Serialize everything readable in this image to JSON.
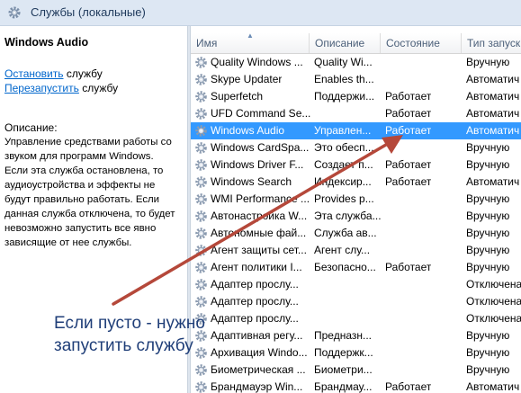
{
  "window": {
    "title": "Службы (локальные)"
  },
  "left_panel": {
    "service_name": "Windows Audio",
    "stop_link": "Остановить",
    "stop_suffix": " службу",
    "restart_link": "Перезапустить",
    "restart_suffix": " службу",
    "description_label": "Описание:",
    "description_lines": [
      "Управление средствами работы со",
      "звуком для программ Windows.",
      "Если эта служба остановлена, то",
      "аудиоустройства и эффекты не",
      "будут правильно работать.  Если",
      "данная служба отключена, то будет",
      "невозможно запустить все явно",
      "зависящие от нее службы."
    ]
  },
  "table": {
    "columns": [
      "Имя",
      "Описание",
      "Состояние",
      "Тип запуск"
    ],
    "sort_indicator": "▲",
    "rows": [
      {
        "name": "Quality Windows ...",
        "desc": "Quality Wi...",
        "state": "",
        "startup": "Вручную"
      },
      {
        "name": "Skype Updater",
        "desc": "Enables th...",
        "state": "",
        "startup": "Автоматич"
      },
      {
        "name": "Superfetch",
        "desc": "Поддержи...",
        "state": "Работает",
        "startup": "Автоматич"
      },
      {
        "name": "UFD Command Se...",
        "desc": "",
        "state": "Работает",
        "startup": "Автоматич"
      },
      {
        "name": "Windows Audio",
        "desc": "Управлен...",
        "state": "Работает",
        "startup": "Автоматич"
      },
      {
        "name": "Windows CardSpa...",
        "desc": "Это обесп...",
        "state": "",
        "startup": "Вручную"
      },
      {
        "name": "Windows Driver F...",
        "desc": "Создает п...",
        "state": "Работает",
        "startup": "Вручную"
      },
      {
        "name": "Windows Search",
        "desc": "Индексир...",
        "state": "Работает",
        "startup": "Автоматич"
      },
      {
        "name": "WMI Performance ...",
        "desc": "Provides p...",
        "state": "",
        "startup": "Вручную"
      },
      {
        "name": "Автонастройка W...",
        "desc": "Эта служба...",
        "state": "",
        "startup": "Вручную"
      },
      {
        "name": "Автономные фай...",
        "desc": "Служба ав...",
        "state": "",
        "startup": "Вручную"
      },
      {
        "name": "Агент защиты сет...",
        "desc": "Агент слу...",
        "state": "",
        "startup": "Вручную"
      },
      {
        "name": "Агент политики I...",
        "desc": "Безопасно...",
        "state": "Работает",
        "startup": "Вручную"
      },
      {
        "name": "Адаптер прослу...",
        "desc": "",
        "state": "",
        "startup": "Отключена"
      },
      {
        "name": "Адаптер прослу...",
        "desc": "",
        "state": "",
        "startup": "Отключена"
      },
      {
        "name": "Адаптер прослу...",
        "desc": "",
        "state": "",
        "startup": "Отключена"
      },
      {
        "name": "Адаптивная регу...",
        "desc": "Предназн...",
        "state": "",
        "startup": "Вручную"
      },
      {
        "name": "Архивация Windo...",
        "desc": "Поддержк...",
        "state": "",
        "startup": "Вручную"
      },
      {
        "name": "Биометрическая ...",
        "desc": "Биометри...",
        "state": "",
        "startup": "Вручную"
      },
      {
        "name": "Брандмауэр Win...",
        "desc": "Брандмау...",
        "state": "Работает",
        "startup": "Автоматич"
      }
    ]
  },
  "annotation": {
    "line1": "Если пусто - нужно",
    "line2": "запустить службу"
  },
  "colors": {
    "selection": "#3399ff",
    "arrow": "#b5483a",
    "link": "#0066cc",
    "annotation": "#1f3e78"
  }
}
